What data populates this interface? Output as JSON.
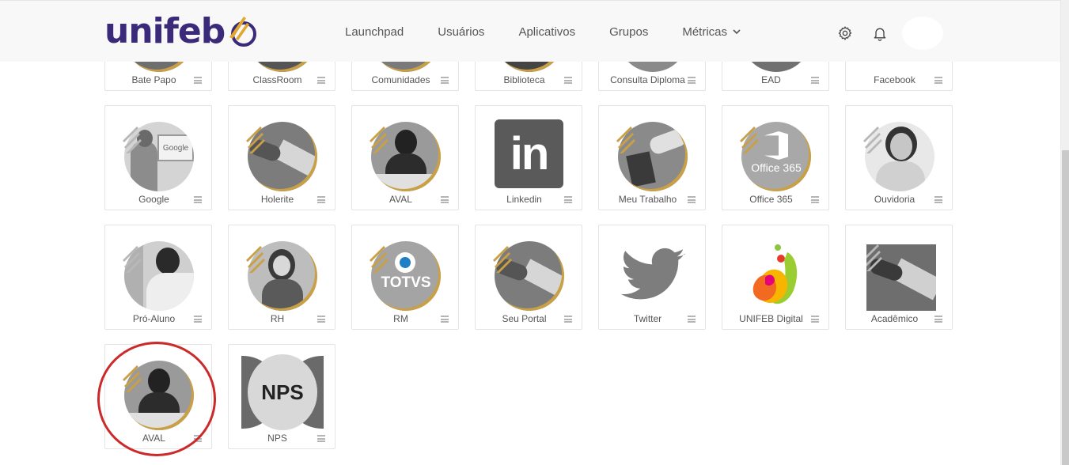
{
  "header": {
    "logo_text": "unifeb",
    "nav": [
      "Launchpad",
      "Usuários",
      "Aplicativos",
      "Grupos",
      "Métricas"
    ]
  },
  "icons": {
    "settings": "gear-icon",
    "notifications": "bell-icon",
    "menu": "hamburger-icon"
  },
  "colors": {
    "brand": "#3b2a7a",
    "gold": "#c9a046",
    "highlight": "#cc2a2a"
  },
  "tiles": [
    {
      "label": "Bate Papo"
    },
    {
      "label": "ClassRoom"
    },
    {
      "label": "Comunidades"
    },
    {
      "label": "Biblioteca"
    },
    {
      "label": "Consulta Diploma"
    },
    {
      "label": "EAD"
    },
    {
      "label": "Facebook"
    },
    {
      "label": "Google",
      "thumb_text": "Google"
    },
    {
      "label": "Holerite"
    },
    {
      "label": "AVAL"
    },
    {
      "label": "Linkedin",
      "thumb_text": "in"
    },
    {
      "label": "Meu Trabalho"
    },
    {
      "label": "Office 365",
      "thumb_text": "Office 365"
    },
    {
      "label": "Ouvidoria"
    },
    {
      "label": "Pró-Aluno"
    },
    {
      "label": "RH"
    },
    {
      "label": "RM",
      "thumb_text": "TOTVS"
    },
    {
      "label": "Seu Portal"
    },
    {
      "label": "Twitter"
    },
    {
      "label": "UNIFEB Digital"
    },
    {
      "label": "Acadêmico"
    },
    {
      "label": "AVAL"
    },
    {
      "label": "NPS",
      "thumb_text": "NPS"
    }
  ]
}
